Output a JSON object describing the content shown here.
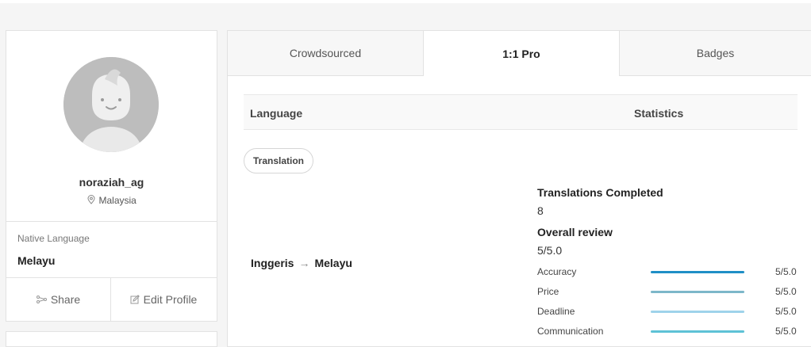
{
  "profile": {
    "username": "noraziah_ag",
    "location": "Malaysia",
    "native_language_label": "Native Language",
    "native_language": "Melayu",
    "share_label": "Share",
    "edit_label": "Edit Profile"
  },
  "tabs": [
    {
      "label": "Crowdsourced",
      "active": false
    },
    {
      "label": "1:1 Pro",
      "active": true
    },
    {
      "label": "Badges",
      "active": false
    }
  ],
  "table": {
    "language_header": "Language",
    "statistics_header": "Statistics",
    "category_pill": "Translation",
    "pair": {
      "from": "Inggeris",
      "arrow": "→",
      "to": "Melayu"
    },
    "translations_completed_label": "Translations Completed",
    "translations_completed": "8",
    "overall_review_label": "Overall review",
    "overall_review": "5/5.0",
    "ratings": [
      {
        "label": "Accuracy",
        "score": "5/5.0",
        "fraction": 1.0,
        "color": "#1f8fc6"
      },
      {
        "label": "Price",
        "score": "5/5.0",
        "fraction": 1.0,
        "color": "#7db7c9"
      },
      {
        "label": "Deadline",
        "score": "5/5.0",
        "fraction": 1.0,
        "color": "#9fd3ea"
      },
      {
        "label": "Communication",
        "score": "5/5.0",
        "fraction": 1.0,
        "color": "#5ec2d6"
      }
    ]
  }
}
